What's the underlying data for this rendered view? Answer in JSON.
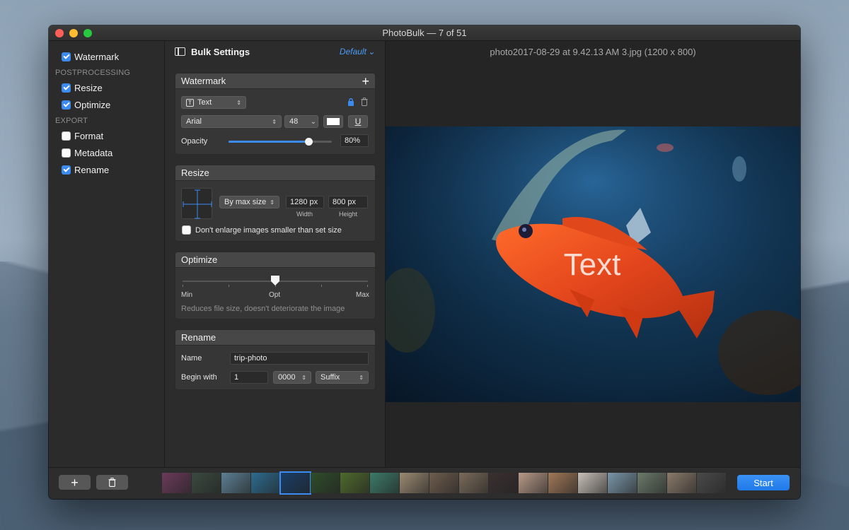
{
  "window": {
    "title": "PhotoBulk — 7 of 51"
  },
  "sidebar": {
    "items": [
      {
        "label": "Watermark",
        "checked": true
      },
      {
        "section": "POSTPROCESSING"
      },
      {
        "label": "Resize",
        "checked": true
      },
      {
        "label": "Optimize",
        "checked": true
      },
      {
        "section": "EXPORT"
      },
      {
        "label": "Format",
        "checked": false
      },
      {
        "label": "Metadata",
        "checked": false
      },
      {
        "label": "Rename",
        "checked": true
      }
    ]
  },
  "settings": {
    "title": "Bulk Settings",
    "preset": "Default",
    "watermark": {
      "header": "Watermark",
      "type": "Text",
      "font": "Arial",
      "size": "48",
      "color": "#ffffff",
      "underline_label": "U",
      "opacity_label": "Opacity",
      "opacity_value": "80%",
      "opacity_fraction": 0.8
    },
    "resize": {
      "header": "Resize",
      "mode": "By max size",
      "width": "1280 px",
      "height": "800 px",
      "width_label": "Width",
      "height_label": "Height",
      "dont_enlarge_label": "Don't enlarge images smaller than set size",
      "dont_enlarge_checked": false
    },
    "optimize": {
      "header": "Optimize",
      "min_label": "Min",
      "opt_label": "Opt",
      "max_label": "Max",
      "description": "Reduces file size, doesn't deteriorate the image"
    },
    "rename": {
      "header": "Rename",
      "name_label": "Name",
      "name_value": "trip-photo",
      "begin_label": "Begin with",
      "begin_value": "1",
      "digits": "0000",
      "position": "Suffix"
    }
  },
  "preview": {
    "filename": "photo2017-08-29 at 9.42.13 AM 3.jpg (1200 x 800)",
    "watermark_text": "Text"
  },
  "bottom": {
    "start_label": "Start",
    "thumbnails": [
      {
        "color": "#6b3a5a"
      },
      {
        "color": "#3a4a3f"
      },
      {
        "color": "#5c7f93"
      },
      {
        "color": "#2d6b8f"
      },
      {
        "color": "#1a3d66",
        "selected": true
      },
      {
        "color": "#2f4d2a"
      },
      {
        "color": "#4e6a2c"
      },
      {
        "color": "#3c7a68"
      },
      {
        "color": "#9b8a72"
      },
      {
        "color": "#6e5d4e"
      },
      {
        "color": "#7a6a5a"
      },
      {
        "color": "#3a3030"
      },
      {
        "color": "#b89a88"
      },
      {
        "color": "#a07858"
      },
      {
        "color": "#c8c0b8"
      },
      {
        "color": "#7a96a8"
      },
      {
        "color": "#6b7a6a"
      },
      {
        "color": "#8a7a6a"
      },
      {
        "color": "#4a4a4a"
      }
    ]
  }
}
